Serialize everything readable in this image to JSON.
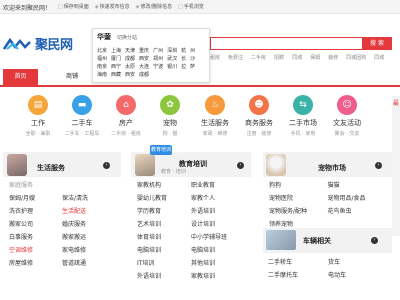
{
  "topbar": {
    "welcome": "欢迎来到聚民网！",
    "links": [
      {
        "icon": "□",
        "label": "保存到桌面"
      },
      {
        "icon": "◈",
        "label": "快速发布信息"
      },
      {
        "icon": "◈",
        "label": "修改/删除信息"
      },
      {
        "icon": "□",
        "label": "手机浏览"
      }
    ]
  },
  "logo": {
    "name": "聚民网"
  },
  "city_popup": {
    "current": "华蓥",
    "switch_label": "切换分站",
    "cities": [
      "北京",
      "上海",
      "天津",
      "重庆",
      "广州",
      "深圳",
      "杭",
      "州",
      "福州",
      "厦门",
      "成都",
      "西安",
      "郑州",
      "武汉",
      "长",
      "沙",
      "南京",
      "西宁",
      "太原",
      "大连",
      "宁波",
      "银川",
      "拉",
      "萨",
      "海南",
      "西藏",
      "西安",
      "成都"
    ]
  },
  "search": {
    "button_label": "搜 索"
  },
  "hotwords": [
    "租房",
    "免费注",
    "二手房",
    "招聘",
    "同城",
    "保姆",
    "装修",
    "同城团购",
    "同城"
  ],
  "nav": {
    "home": "首页",
    "mall": "商铺"
  },
  "categories": [
    {
      "icon": "briefcase-icon",
      "glyph": "▤",
      "color": "#f4a63a",
      "label": "工作",
      "subs": "全职 · 兼职"
    },
    {
      "icon": "car-icon",
      "glyph": "▬",
      "color": "#3aa1e8",
      "label": "二手车",
      "subs": "二手车 · 工程车"
    },
    {
      "icon": "house-icon",
      "glyph": "⌂",
      "color": "#f36a6a",
      "label": "房产",
      "subs": "二手房 · 租房"
    },
    {
      "icon": "paw-icon",
      "glyph": "✿",
      "color": "#8cc63f",
      "label": "宠物",
      "subs": "狗 · 猫"
    },
    {
      "icon": "life-service-icon",
      "glyph": "♨",
      "color": "#f79a3e",
      "label": "生活服务",
      "subs": "家政 · 维修"
    },
    {
      "icon": "business-service-icon",
      "glyph": "☻",
      "color": "#f4744a",
      "label": "商务服务",
      "subs": "注册 · 装修"
    },
    {
      "icon": "second-hand-icon",
      "glyph": "⇆",
      "color": "#39b3a8",
      "label": "二手市场",
      "subs": "手机 · 家电"
    },
    {
      "icon": "culture-icon",
      "glyph": "☺",
      "color": "#ef5d8a",
      "label": "文友活动",
      "subs": "聚会 · 交友"
    }
  ],
  "side_widget": {
    "label": "最"
  },
  "panels": {
    "life": {
      "title": "生活服务",
      "items": [
        {
          "text": "家庭服务",
          "style": "muted"
        },
        {
          "text": "",
          "style": ""
        },
        {
          "text": "保姆/月嫂",
          "style": ""
        },
        {
          "text": "保洁/清洗",
          "style": ""
        },
        {
          "text": "洗衣护理",
          "style": ""
        },
        {
          "text": "生活配送",
          "style": "red"
        },
        {
          "text": "搬家公司",
          "style": ""
        },
        {
          "text": "婚庆服务",
          "style": ""
        },
        {
          "text": "白事服务",
          "style": ""
        },
        {
          "text": "搬家搬运",
          "style": ""
        },
        {
          "text": "空调维修",
          "style": "red"
        },
        {
          "text": "家电维修",
          "style": ""
        },
        {
          "text": "房屋维修",
          "style": ""
        },
        {
          "text": "管道疏通",
          "style": ""
        }
      ]
    },
    "training": {
      "title": "教育培训",
      "tag": "教育培训",
      "subtitle": "教育 · 培训",
      "items": [
        "家教机构",
        "职业教育",
        "婴幼儿教育",
        "家教个人",
        "学历教育",
        "外语培训",
        "艺术培训",
        "设计培训",
        "体育培训",
        "中小学辅导班",
        "电脑培训",
        "电脑培训",
        "IT培训",
        "其他培训",
        "外语培训",
        "家教培训"
      ]
    },
    "pet": {
      "title": "宠物市场",
      "items": [
        "狗狗",
        "猫猫",
        "宠物医院",
        "宠物用品/食品",
        "宠物服务/配种",
        "花鸟鱼虫",
        "领养宠物",
        ""
      ]
    },
    "car": {
      "title": "车辆相关",
      "items": [
        "二手轿车",
        "货车",
        "二手摩托车",
        "电动车"
      ]
    }
  }
}
